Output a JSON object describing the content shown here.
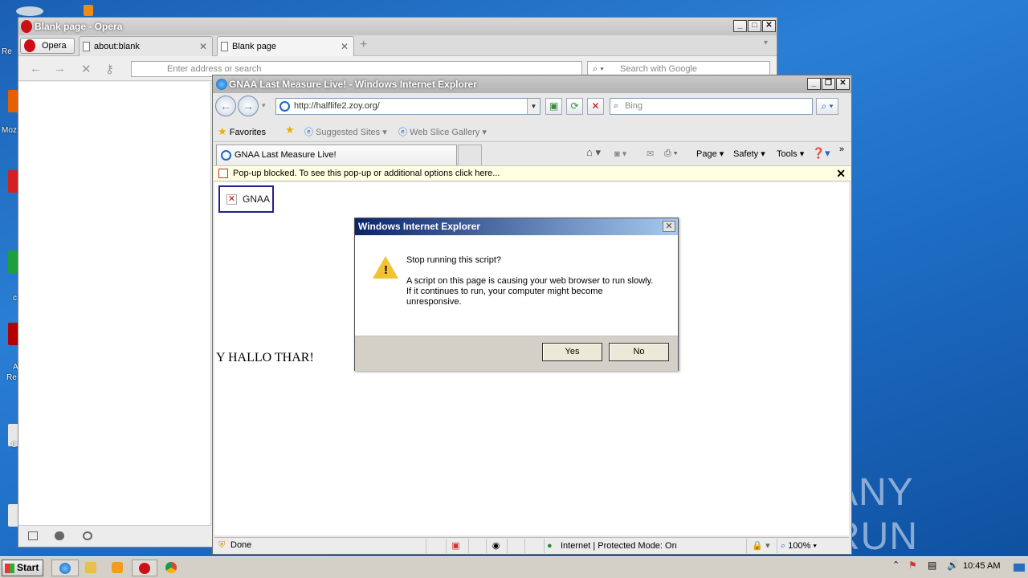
{
  "desktop": {
    "label_fragments": [
      "Re",
      "Moz",
      "c",
      "A",
      "Re",
      "C"
    ]
  },
  "watermark": {
    "text": "ANY RUN"
  },
  "opera": {
    "window_title": "Blank page - Opera",
    "menu_label": "Opera",
    "tabs": [
      {
        "label": "about:blank"
      },
      {
        "label": "Blank page"
      }
    ],
    "address_placeholder": "Enter address or search",
    "search_placeholder": "Search with Google"
  },
  "ie": {
    "window_title": "GNAA Last Measure Live! - Windows Internet Explorer",
    "url": "http://halflife2.zoy.org/",
    "search_placeholder": "Bing",
    "favorites": {
      "favorites_label": "Favorites",
      "suggested_sites": "Suggested Sites",
      "web_slice_gallery": "Web Slice Gallery"
    },
    "tab_title": "GNAA Last Measure Live!",
    "commands": {
      "page": "Page",
      "safety": "Safety",
      "tools": "Tools"
    },
    "popup_message": "Pop-up blocked. To see this pop-up or additional options click here...",
    "content": {
      "broken_image_alt": "GNAA",
      "body_text": "Y HALLO THAR!"
    },
    "status": {
      "left": "Done",
      "zone": "Internet | Protected Mode: On",
      "zoom": "100%"
    }
  },
  "dialog": {
    "title": "Windows Internet Explorer",
    "question": "Stop running this script?",
    "message_lines": [
      "A script on this page is causing your web browser to run slowly.",
      "If it continues to run, your computer might become",
      "unresponsive."
    ],
    "yes_label": "Yes",
    "no_label": "No"
  },
  "taskbar": {
    "start_label": "Start",
    "clock": "10:45 AM"
  },
  "colors": {
    "desktop_blue": "#1a5fb4",
    "dialog_title_start": "#0a246a",
    "popup_bar": "#ffffe1",
    "gnaa_border": "#22228a"
  }
}
